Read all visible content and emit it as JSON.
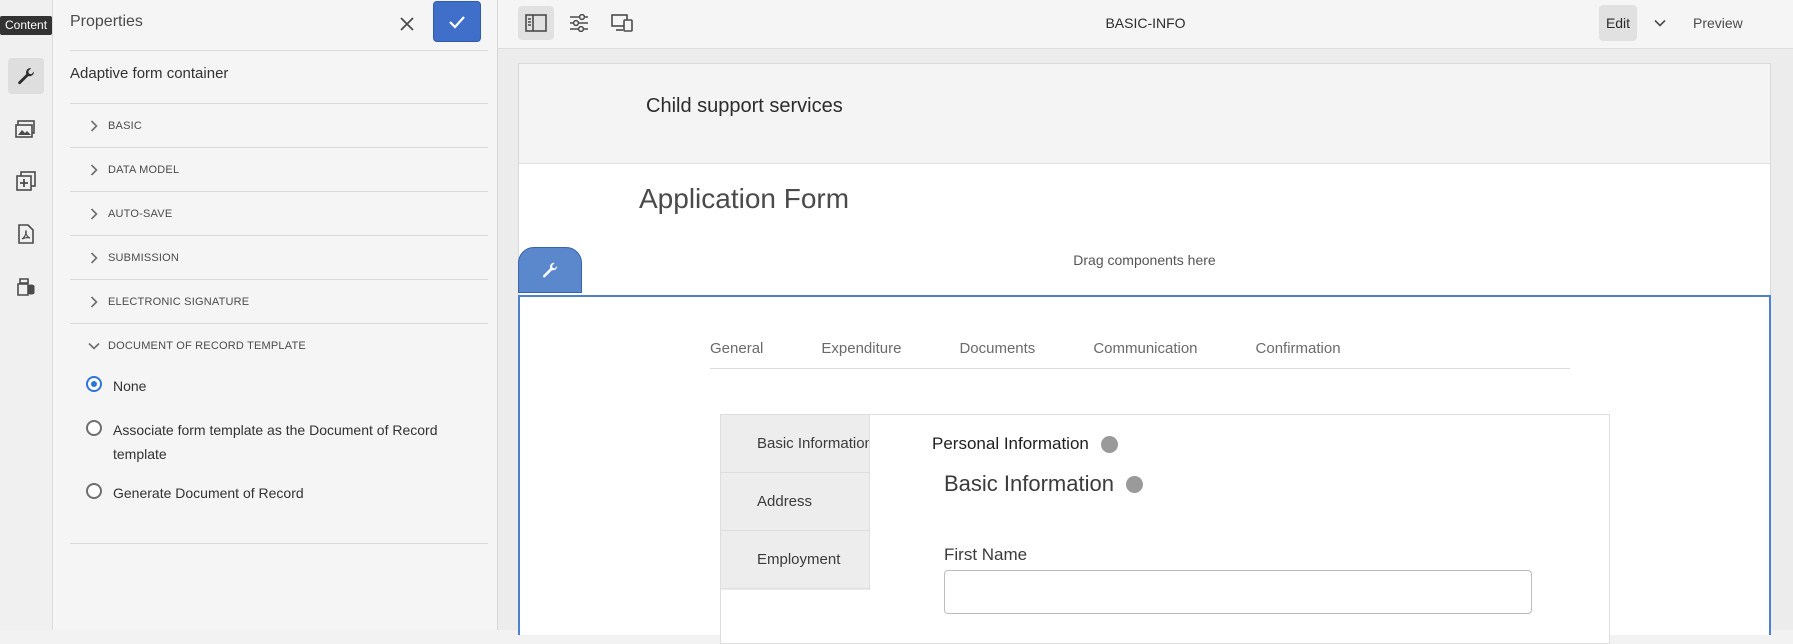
{
  "rail": {
    "tooltip": "Content",
    "icons": [
      "wrench-icon",
      "assets-icon",
      "add-component-icon",
      "pdf-icon",
      "data-sources-icon"
    ]
  },
  "panel": {
    "title": "Properties",
    "subtitle": "Adaptive form container",
    "sections": [
      {
        "label": "BASIC",
        "expanded": false
      },
      {
        "label": "DATA MODEL",
        "expanded": false
      },
      {
        "label": "AUTO-SAVE",
        "expanded": false
      },
      {
        "label": "SUBMISSION",
        "expanded": false
      },
      {
        "label": "ELECTRONIC SIGNATURE",
        "expanded": false
      },
      {
        "label": "DOCUMENT OF RECORD TEMPLATE",
        "expanded": true
      }
    ],
    "dor_options": [
      {
        "label": "None",
        "checked": true
      },
      {
        "label": "Associate form template as the Document of Record template",
        "checked": false
      },
      {
        "label": "Generate Document of Record",
        "checked": false
      }
    ]
  },
  "toolbar": {
    "page_name": "BASIC-INFO",
    "mode": "Edit",
    "preview": "Preview"
  },
  "page": {
    "header_title": "Child support services",
    "form_title": "Application Form",
    "drop_hint": "Drag components here",
    "tabs": [
      "General",
      "Expenditure",
      "Documents",
      "Communication",
      "Confirmation"
    ],
    "vertical_tabs": [
      "Basic Information",
      "Address",
      "Employment"
    ],
    "section_title": "Personal Information",
    "subsection_title": "Basic Information",
    "first_name_label": "First Name",
    "first_name_value": ""
  },
  "colors": {
    "accent": "#3f6fc9",
    "container_border": "#4d80cf",
    "radio_checked": "#2d74da"
  }
}
